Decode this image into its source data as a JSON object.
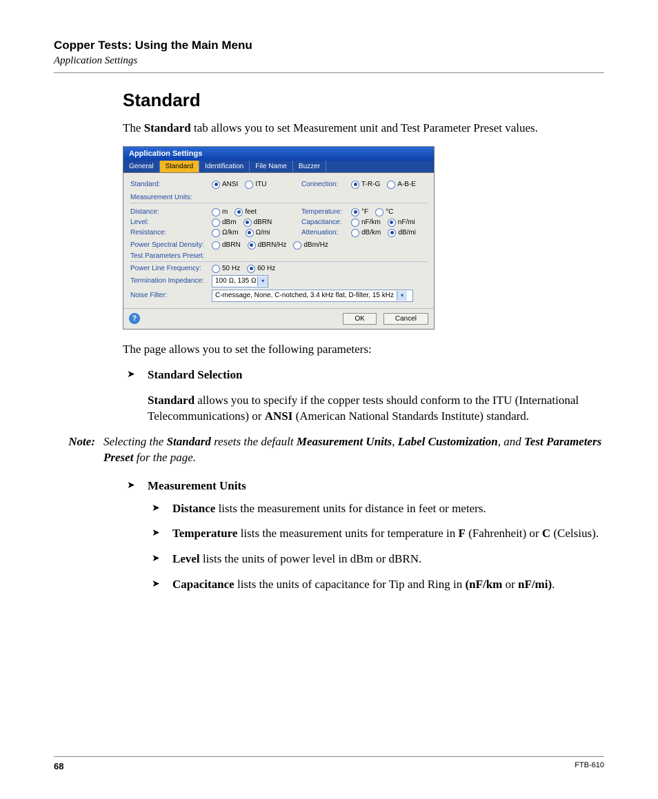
{
  "header": {
    "chapter": "Copper Tests: Using the Main Menu",
    "section": "Application Settings"
  },
  "title": "Standard",
  "intro_pre": "The ",
  "intro_bold": "Standard",
  "intro_post": " tab allows you to set Measurement unit and Test Parameter Preset values.",
  "shot": {
    "window_title": "Application Settings",
    "tabs": [
      "General",
      "Standard",
      "Identification",
      "File Name",
      "Buzzer"
    ],
    "active_tab_index": 1,
    "standard_label": "Standard:",
    "standard_opts": [
      "ANSI",
      "ITU"
    ],
    "standard_sel": 0,
    "connection_label": "Connection:",
    "connection_opts": [
      "T-R-G",
      "A-B-E"
    ],
    "connection_sel": 0,
    "mu_legend": "Measurement Units:",
    "distance_label": "Distance:",
    "distance_opts": [
      "m",
      "feet"
    ],
    "distance_sel": 1,
    "temperature_label": "Temperature:",
    "temperature_opts": [
      "°F",
      "°C"
    ],
    "temperature_sel": 0,
    "level_label": "Level:",
    "level_opts": [
      "dBm",
      "dBRN"
    ],
    "level_sel": 1,
    "capacitance_label": "Capacitance:",
    "capacitance_opts": [
      "nF/km",
      "nF/mi"
    ],
    "capacitance_sel": 1,
    "resistance_label": "Resistance:",
    "resistance_opts": [
      "Ω/km",
      "Ω/mi"
    ],
    "resistance_sel": 1,
    "attenuation_label": "Attenuation:",
    "attenuation_opts": [
      "dB/km",
      "dB/mi"
    ],
    "attenuation_sel": 1,
    "psd_label": "Power Spectral Density:",
    "psd_opts": [
      "dBRN",
      "dBRN/Hz",
      "dBm/Hz"
    ],
    "psd_sel": 1,
    "tpp_legend": "Test Parameters Preset:",
    "plf_label": "Power Line Frequency:",
    "plf_opts": [
      "50 Hz",
      "60 Hz"
    ],
    "plf_sel": 1,
    "ti_label": "Termination Impedance:",
    "ti_value": "100 Ω, 135 Ω",
    "nf_label": "Noise Filter:",
    "nf_value": "C-message, None, C-notched, 3.4 kHz flat, D-filter, 15 kHz",
    "help_glyph": "?",
    "ok": "OK",
    "cancel": "Cancel"
  },
  "after_shot": "The page allows you to set the following parameters:",
  "b1_title": "Standard Selection",
  "b1_p1_bold1": "Standard",
  "b1_p1_mid": " allows you to specify if the copper tests should conform to the ITU (International Telecommunications) or ",
  "b1_p1_bold2": "ANSI",
  "b1_p1_end": " (American National Standards Institute) standard.",
  "note_label": "Note:",
  "note_t1": "Selecting the ",
  "note_b1": "Standard",
  "note_t2": " resets the default ",
  "note_b2": "Measurement Units",
  "note_t3": ", ",
  "note_b3": "Label Customization",
  "note_t4": ", and ",
  "note_b4": "Test Parameters Preset",
  "note_t5": " for the page.",
  "b2_title": "Measurement Units",
  "sub": {
    "d_b": "Distance",
    "d_t": " lists the measurement units for distance in feet or meters.",
    "t_b": "Temperature",
    "t_t1": " lists the measurement units for temperature in ",
    "t_bF": "F",
    "t_mid": " (Fahrenheit) or ",
    "t_bC": "C",
    "t_end": " (Celsius).",
    "l_b": "Level",
    "l_t": " lists the units of power level in dBm or dBRN.",
    "c_b": "Capacitance",
    "c_t1": " lists the units of capacitance for Tip and Ring in ",
    "c_b2": "(nF/km",
    "c_mid": " or ",
    "c_b3": "nF/mi)",
    "c_end": "."
  },
  "footer": {
    "page": "68",
    "doc": "FTB-610"
  }
}
